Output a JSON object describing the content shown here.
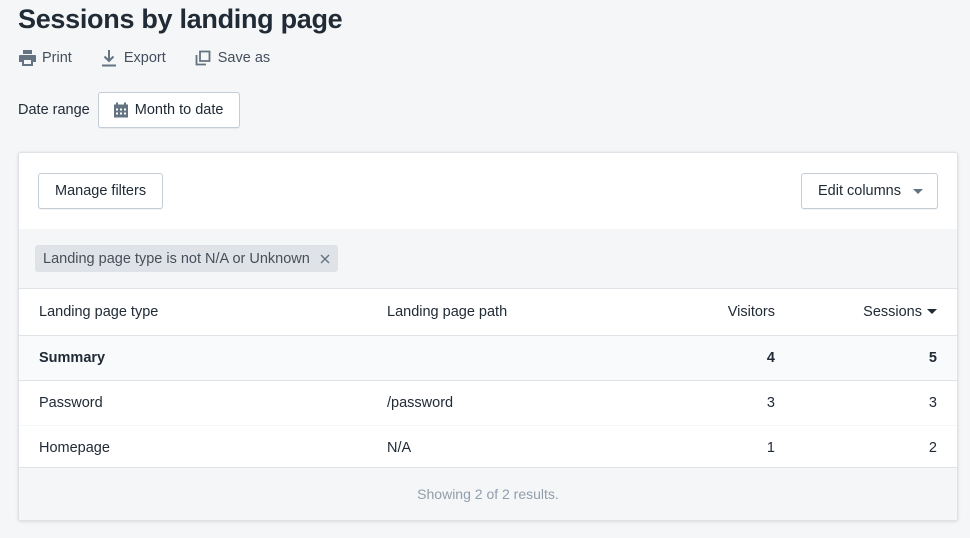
{
  "page": {
    "title": "Sessions by landing page"
  },
  "actions": {
    "print_label": "Print",
    "export_label": "Export",
    "save_as_label": "Save as"
  },
  "date_range": {
    "label": "Date range",
    "value": "Month to date"
  },
  "toolbar": {
    "manage_filters_label": "Manage filters",
    "edit_columns_label": "Edit columns"
  },
  "filters": [
    {
      "label": "Landing page type is not N/A or Unknown"
    }
  ],
  "table": {
    "columns": [
      "Landing page type",
      "Landing page path",
      "Visitors",
      "Sessions"
    ],
    "sorted_column": "Sessions",
    "sort_direction": "descending",
    "summary": {
      "label": "Summary",
      "path": "",
      "visitors": "4",
      "sessions": "5"
    },
    "rows": [
      {
        "type": "Password",
        "path": "/password",
        "visitors": "3",
        "sessions": "3"
      },
      {
        "type": "Homepage",
        "path": "N/A",
        "visitors": "1",
        "sessions": "2"
      }
    ]
  },
  "footer": {
    "results_text": "Showing 2 of 2 results."
  },
  "colors": {
    "background": "#f4f6f8",
    "text": "#212b36",
    "muted": "#919eab",
    "border": "#dfe3e8",
    "tag_bg": "#dfe3e8"
  }
}
